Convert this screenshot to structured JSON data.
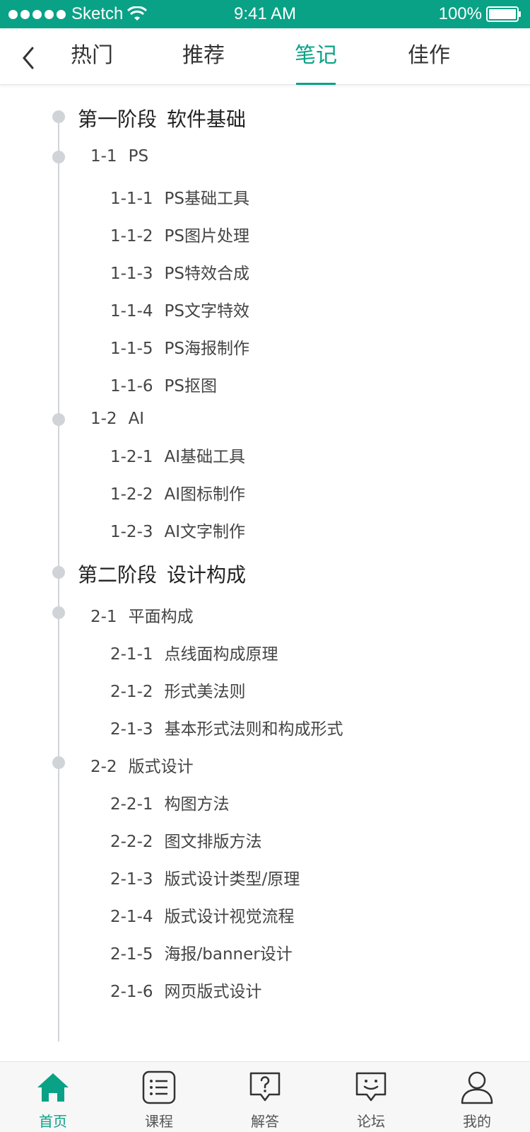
{
  "status_bar": {
    "carrier": "Sketch",
    "time": "9:41 AM",
    "battery": "100%"
  },
  "nav": {
    "back_icon": "chevron-left-icon",
    "tabs": [
      {
        "label": "热门",
        "active": false
      },
      {
        "label": "推荐",
        "active": false
      },
      {
        "label": "笔记",
        "active": true
      },
      {
        "label": "佳作",
        "active": false
      }
    ],
    "accent_color": "#0aa286"
  },
  "outline": [
    {
      "level": 0,
      "code": "第一阶段",
      "title": "软件基础"
    },
    {
      "level": 1,
      "code": "1-1",
      "title": "PS"
    },
    {
      "level": 2,
      "code": "1-1-1",
      "title": "PS基础工具"
    },
    {
      "level": 2,
      "code": "1-1-2",
      "title": "PS图片处理"
    },
    {
      "level": 2,
      "code": "1-1-3",
      "title": "PS特效合成"
    },
    {
      "level": 2,
      "code": "1-1-4",
      "title": "PS文字特效"
    },
    {
      "level": 2,
      "code": "1-1-5",
      "title": "PS海报制作"
    },
    {
      "level": 2,
      "code": "1-1-6",
      "title": "PS抠图"
    },
    {
      "level": 1,
      "code": "1-2",
      "title": "AI"
    },
    {
      "level": 2,
      "code": "1-2-1",
      "title": "AI基础工具"
    },
    {
      "level": 2,
      "code": "1-2-2",
      "title": "AI图标制作"
    },
    {
      "level": 2,
      "code": "1-2-3",
      "title": "AI文字制作"
    },
    {
      "level": 0,
      "code": "第二阶段",
      "title": "设计构成"
    },
    {
      "level": 1,
      "code": "2-1",
      "title": "平面构成"
    },
    {
      "level": 2,
      "code": "2-1-1",
      "title": "点线面构成原理"
    },
    {
      "level": 2,
      "code": "2-1-2",
      "title": "形式美法则"
    },
    {
      "level": 2,
      "code": "2-1-3",
      "title": "基本形式法则和构成形式"
    },
    {
      "level": 1,
      "code": "2-2",
      "title": "版式设计"
    },
    {
      "level": 2,
      "code": "2-2-1",
      "title": "构图方法"
    },
    {
      "level": 2,
      "code": "2-2-2",
      "title": "图文排版方法"
    },
    {
      "level": 2,
      "code": "2-1-3",
      "title": "版式设计类型/原理"
    },
    {
      "level": 2,
      "code": "2-1-4",
      "title": "版式设计视觉流程"
    },
    {
      "level": 2,
      "code": "2-1-5",
      "title": "海报/banner设计"
    },
    {
      "level": 2,
      "code": "2-1-6",
      "title": "网页版式设计"
    }
  ],
  "tab_bar": [
    {
      "label": "首页",
      "icon": "home-icon",
      "active": true
    },
    {
      "label": "课程",
      "icon": "list-icon",
      "active": false
    },
    {
      "label": "解答",
      "icon": "question-bubble-icon",
      "active": false
    },
    {
      "label": "论坛",
      "icon": "smile-bubble-icon",
      "active": false
    },
    {
      "label": "我的",
      "icon": "user-icon",
      "active": false
    }
  ]
}
